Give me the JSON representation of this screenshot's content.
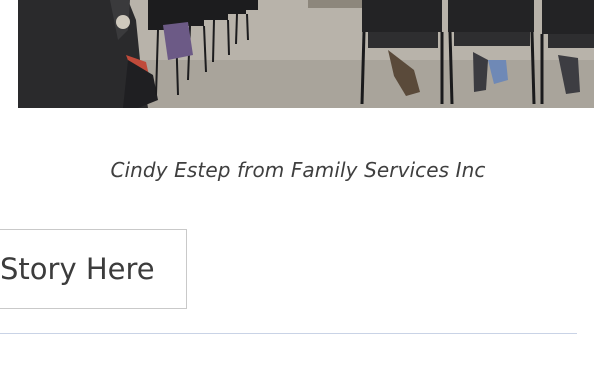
{
  "photo": {
    "alt": "Cindy Estep from Family Services Inc"
  },
  "caption": "Cindy Estep from Family Services Inc",
  "story_button": {
    "label": "Story Here"
  },
  "next_section": {
    "heading": ""
  },
  "colors": {
    "caption_text": "#3f3f3f",
    "button_border": "#c9c9c9",
    "divider": "#c9d3e6",
    "heading_blue": "#2f5fa8"
  }
}
